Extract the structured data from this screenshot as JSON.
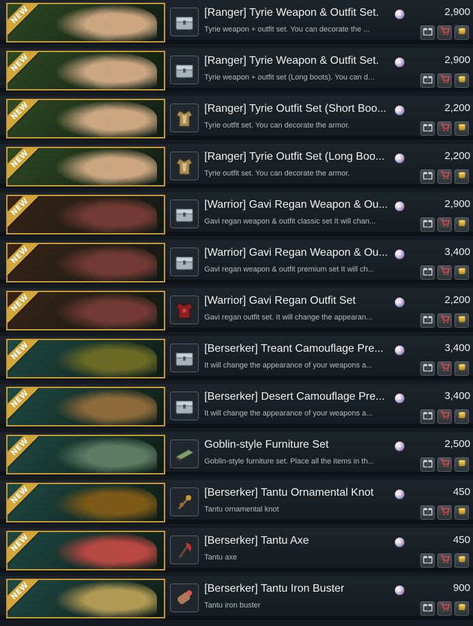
{
  "badge_label": "NEW",
  "colors": {
    "accent_gold": "#c79a3a",
    "row_bg": "#1a2227",
    "text_primary": "#f2f2f2",
    "text_secondary": "#b5bcc2"
  },
  "icons": {
    "gift": "gift-icon",
    "cart": "cart-icon",
    "coin": "coin-icon",
    "currency": "pearl-icon"
  },
  "items": [
    {
      "name": "[Ranger] Tyrie Weapon & Outfit Set.",
      "description": "Tyrie weapon + outfit set. You can decorate the ...",
      "price": "2,900",
      "thumb": "chest-icon",
      "banner_bg": "#2f4a22",
      "art": "#c8a684"
    },
    {
      "name": "[Ranger] Tyrie Weapon & Outfit Set.",
      "description": "Tyrie weapon + outfit set (Long boots). You can d...",
      "price": "2,900",
      "thumb": "chest-icon",
      "banner_bg": "#2f4a22",
      "art": "#c8a684"
    },
    {
      "name": "[Ranger] Tyrie Outfit Set (Short Boo...",
      "description": "Tyrie outfit set. You can decorate the armor.",
      "price": "2,200",
      "thumb": "armor-icon",
      "banner_bg": "#2f4a22",
      "art": "#c8a684"
    },
    {
      "name": "[Ranger] Tyrie Outfit Set (Long Boo...",
      "description": "Tyrie outfit set. You can decorate the armor.",
      "price": "2,200",
      "thumb": "armor-icon",
      "banner_bg": "#2f4a22",
      "art": "#c8a684"
    },
    {
      "name": "[Warrior] Gavi Regan Weapon & Ou...",
      "description": "Gavi regan weapon & outfit classic set It will chan...",
      "price": "2,900",
      "thumb": "chest-icon",
      "banner_bg": "#3a2416",
      "art": "#6e3a36"
    },
    {
      "name": "[Warrior] Gavi Regan Weapon & Ou...",
      "description": "Gavi regan weapon & outfit premium set It will ch...",
      "price": "3,400",
      "thumb": "chest-icon",
      "banner_bg": "#3a2416",
      "art": "#6e3a36"
    },
    {
      "name": "[Warrior] Gavi Regan Outfit Set",
      "description": "Gavi regan outfit set. It will change the appearan...",
      "price": "2,200",
      "thumb": "red-armor-icon",
      "banner_bg": "#3a2416",
      "art": "#6e3a36"
    },
    {
      "name": "[Berserker] Treant Camouflage Pre...",
      "description": "It will change the appearance of your weapons a...",
      "price": "3,400",
      "thumb": "chest-icon",
      "banner_bg": "#1f4a44",
      "art": "#6a6a2a"
    },
    {
      "name": "[Berserker] Desert Camouflage Pre...",
      "description": "It will change the appearance of your weapons a...",
      "price": "3,400",
      "thumb": "chest-icon",
      "banner_bg": "#1f4a44",
      "art": "#8a6a3e"
    },
    {
      "name": "Goblin-style Furniture Set",
      "description": "Goblin-style furniture set. Place all the items in th...",
      "price": "2,500",
      "thumb": "bed-icon",
      "banner_bg": "#1f4a44",
      "art": "#5e7a64"
    },
    {
      "name": "[Berserker] Tantu Ornamental Knot",
      "description": "Tantu ornamental knot",
      "price": "450",
      "thumb": "knot-icon",
      "banner_bg": "#1f4a44",
      "art": "#7a5a1e"
    },
    {
      "name": "[Berserker] Tantu Axe",
      "description": "Tantu axe",
      "price": "450",
      "thumb": "axe-icon",
      "banner_bg": "#1f4a44",
      "art": "#b04a44"
    },
    {
      "name": "[Berserker] Tantu Iron Buster",
      "description": "Tantu iron buster",
      "price": "900",
      "thumb": "buster-icon",
      "banner_bg": "#1f4a44",
      "art": "#b09a5a"
    }
  ]
}
